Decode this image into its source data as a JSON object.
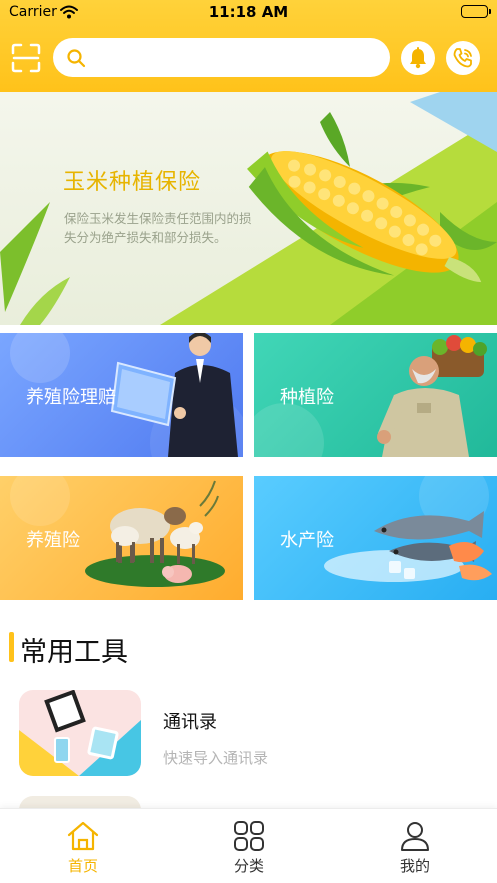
{
  "status_bar": {
    "carrier": "Carrier",
    "time": "11:18 AM"
  },
  "search": {
    "placeholder": "",
    "value": ""
  },
  "banner": {
    "title": "玉米种植保险",
    "description": "保险玉米发生保险责任范围内的损失分为绝产损失和部分损失。"
  },
  "categories": [
    {
      "label": "养殖险理赔"
    },
    {
      "label": "种植险"
    },
    {
      "label": "养殖险"
    },
    {
      "label": "水产险"
    }
  ],
  "tools": {
    "title": "常用工具",
    "items": [
      {
        "name": "通讯录",
        "desc": "快速导入通讯录"
      }
    ]
  },
  "tab_bar": [
    {
      "label": "首页",
      "icon": "home-icon",
      "active": true
    },
    {
      "label": "分类",
      "icon": "grid-icon",
      "active": false
    },
    {
      "label": "我的",
      "icon": "person-icon",
      "active": false
    }
  ],
  "colors": {
    "accent": "#ffc21a",
    "active_tab": "#f5b400"
  }
}
